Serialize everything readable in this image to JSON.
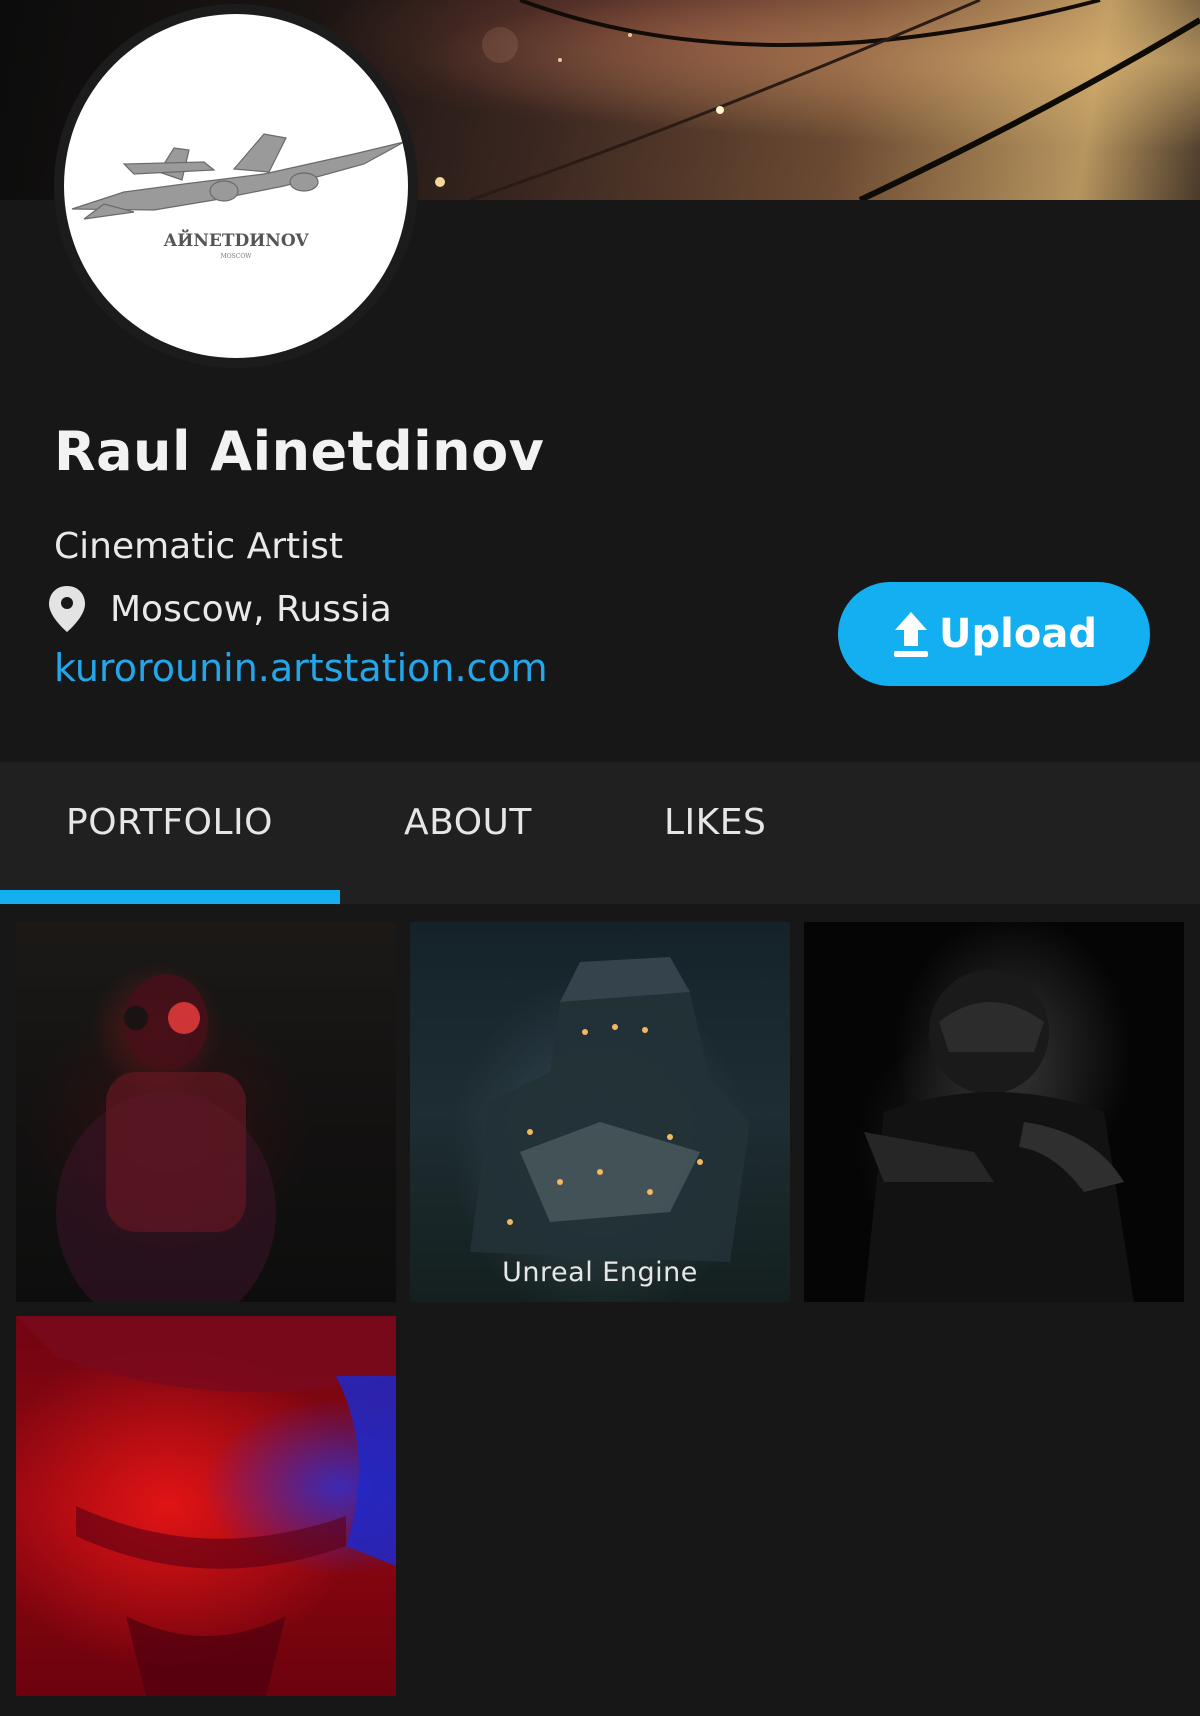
{
  "profile": {
    "name": "Raul Ainetdinov",
    "title": "Cinematic Artist",
    "location": "Moscow, Russia",
    "website": "kurorounin.artstation.com",
    "avatar_logo_text": "АЙNETDИNOV",
    "avatar_logo_subtext": "MOSCOW"
  },
  "actions": {
    "upload_label": "Upload"
  },
  "tabs": [
    {
      "label": "PORTFOLIO",
      "active": true
    },
    {
      "label": "ABOUT",
      "active": false
    },
    {
      "label": "LIKES",
      "active": false
    }
  ],
  "portfolio": [
    {
      "caption": ""
    },
    {
      "caption": "Unreal Engine"
    },
    {
      "caption": ""
    },
    {
      "caption": ""
    }
  ],
  "colors": {
    "background": "#171717",
    "accent": "#13aff0",
    "link": "#24a6e8",
    "tab_bar": "#202020"
  },
  "icons": {
    "location": "map-pin-icon",
    "upload": "upload-arrow-icon"
  }
}
